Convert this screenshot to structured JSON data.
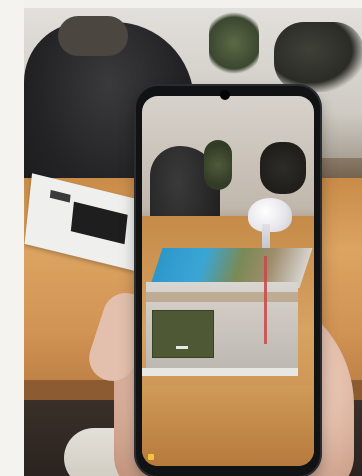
{
  "scene": {
    "description_label": "",
    "phone": {
      "screen_content": "ar-volcano-model"
    },
    "ar_model": {
      "label": ""
    }
  },
  "colors": {
    "table_wood": "#d09353",
    "phone_frame": "#111214",
    "ar_water": "#3aa6d6",
    "ar_panel": "#4e5834",
    "ar_plume": "#e6e6ea"
  }
}
